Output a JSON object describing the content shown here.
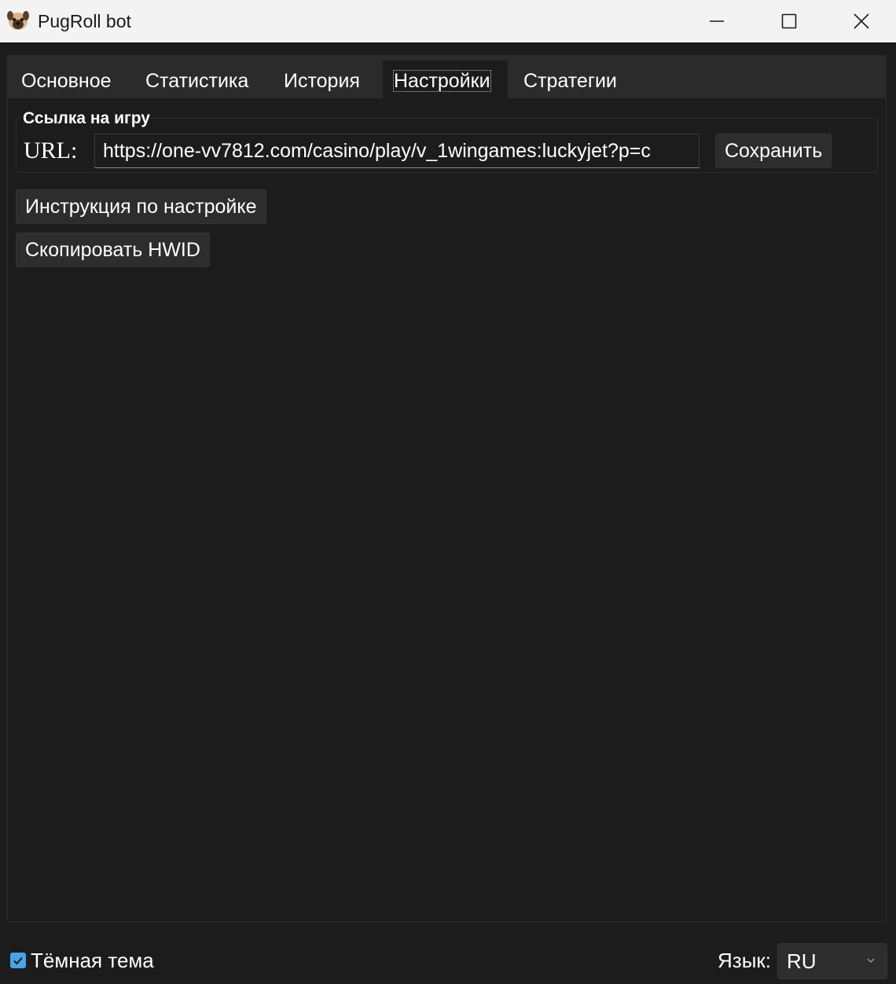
{
  "window": {
    "title": "PugRoll bot",
    "icon": "pug-face-icon"
  },
  "tabs": [
    {
      "label": "Основное",
      "active": false
    },
    {
      "label": "Статистика",
      "active": false
    },
    {
      "label": "История",
      "active": false
    },
    {
      "label": "Настройки",
      "active": true
    },
    {
      "label": "Стратегии",
      "active": false
    }
  ],
  "settings": {
    "group_title": "Ссылка на игру",
    "url_label": "URL:",
    "url_value": "https://one-vv7812.com/casino/play/v_1wingames:luckyjet?p=c",
    "save_label": "Сохранить",
    "instruction_label": "Инструкция по настройке",
    "copy_hwid_label": "Скопировать HWID"
  },
  "footer": {
    "dark_theme_label": "Тёмная тема",
    "dark_theme_checked": true,
    "language_label": "Язык:",
    "language_value": "RU"
  },
  "colors": {
    "background": "#1c1c1c",
    "titlebar": "#f3f3f3",
    "button": "#2d2d2d",
    "accent": "#4aa3e8"
  }
}
